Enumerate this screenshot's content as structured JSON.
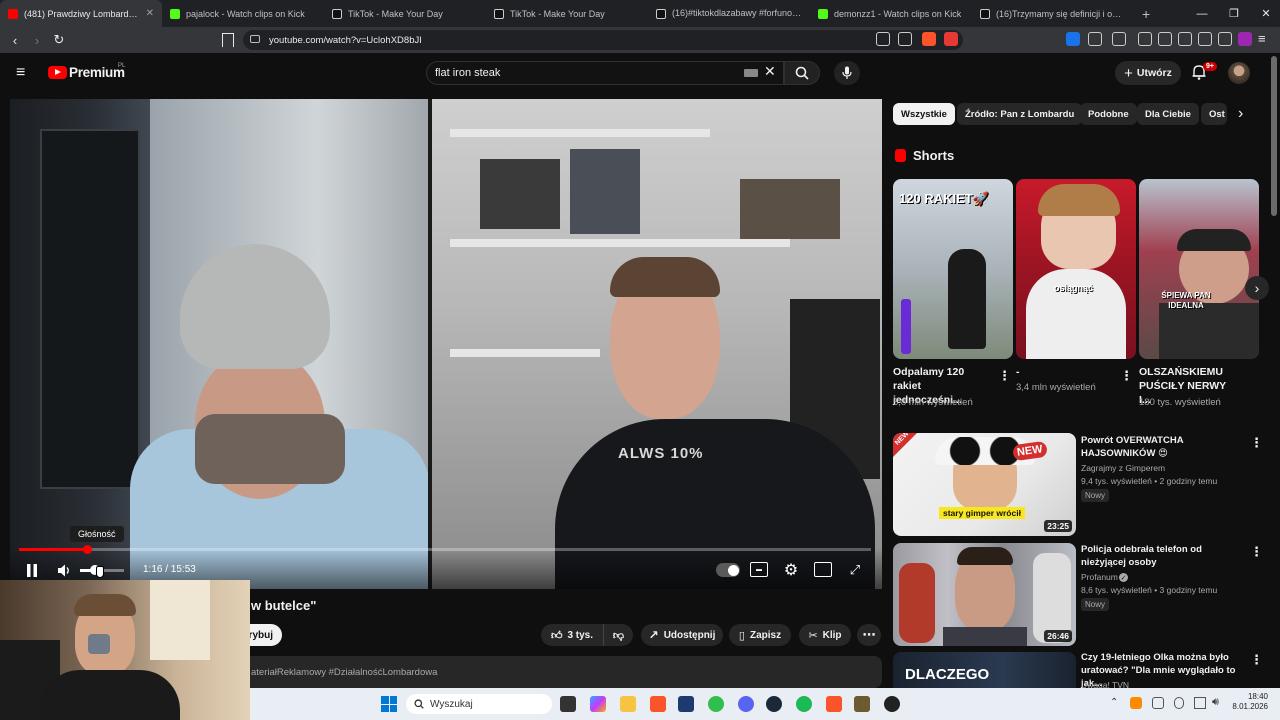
{
  "browser": {
    "tabs": [
      {
        "title": "(481) Prawdziwy Lombard - Ć",
        "color": "#ff0000",
        "active": true
      },
      {
        "title": "pajalock - Watch clips on Kick",
        "color": "#53fc18",
        "active": false
      },
      {
        "title": "TikTok - Make Your Day",
        "color": "#ffffff",
        "active": false
      },
      {
        "title": "TikTok - Make Your Day",
        "color": "#ffffff",
        "active": false
      },
      {
        "title": "(16)#tiktokdlazabawy #forfunonly💜",
        "color": "#ffffff",
        "active": false
      },
      {
        "title": "demonzz1 - Watch clips on Kick",
        "color": "#53fc18",
        "active": false
      },
      {
        "title": "(16)Trzymamy się definicji i obchodz",
        "color": "#ffffff",
        "active": false
      }
    ],
    "url": "youtube.com/watch?v=UclohXD8bJI"
  },
  "youtube": {
    "logo_text": "Premium",
    "logo_region": "PL",
    "search_value": "flat iron steak",
    "create_label": "Utwórz",
    "notif_count": "9+",
    "player": {
      "time": "1:16 / 15:53",
      "volume_tooltip": "Głośność",
      "progress": 0.08
    },
    "title_visible": "w butelce\"",
    "subscribe_partial": "rybuj",
    "actions": {
      "like_count": "3 tys.",
      "share_label": "Udostępnij",
      "save_label": "Zapisz",
      "clip_label": "Klip"
    },
    "hashtags": "ateriałReklamowy #DziałalnośćLombardowa",
    "chips": [
      "Wszystkie",
      "Źródło: Pan z Lombardu",
      "Podobne",
      "Dla Ciebie",
      "Ost"
    ],
    "shorts_heading": "Shorts",
    "shorts": [
      {
        "title": "Odpalamy 120 rakiet jednocześni...",
        "views": "5,8 mln wyświetleń",
        "overlay": "120 RAKIET🚀"
      },
      {
        "title": "-",
        "views": "3,4 mln wyświetleń",
        "overlay": "osiągnąć"
      },
      {
        "title": "OLSZAŃSKIEMU PUŚCIŁY NERWY I...",
        "views": "180 tys. wyświetleń",
        "overlay": "ŚPIEWA PAN IDEALNA"
      }
    ],
    "videos": [
      {
        "title": "Powrót OVERWATCHA HAJSOWNIKÓW 😍",
        "channel": "Zagrajmy z Gimperem",
        "meta": "9,4 tys. wyświetleń • 2 godziny temu",
        "badge": "Nowy",
        "duration": "23:25",
        "thumb_text": "stary gimper wrócił",
        "thumb_badge": "NEW",
        "thumb_corner": "NEW"
      },
      {
        "title": "Policja odebrała telefon od nieżyjącej osoby",
        "channel": "Profanum",
        "meta": "8,6 tys. wyświetleń • 3 godziny temu",
        "badge": "Nowy",
        "duration": "26:46"
      },
      {
        "title": "Czy 19-letniego Olka można było uratować? \"Dla mnie wyglądało to jak...",
        "channel": "Uwaga! TVN",
        "thumb_text": "DLACZEGO"
      }
    ],
    "shirt_text": "ALWS 10%"
  },
  "taskbar": {
    "search_placeholder": "Wyszukaj",
    "time": "18:40",
    "date": "8.01.2026"
  }
}
